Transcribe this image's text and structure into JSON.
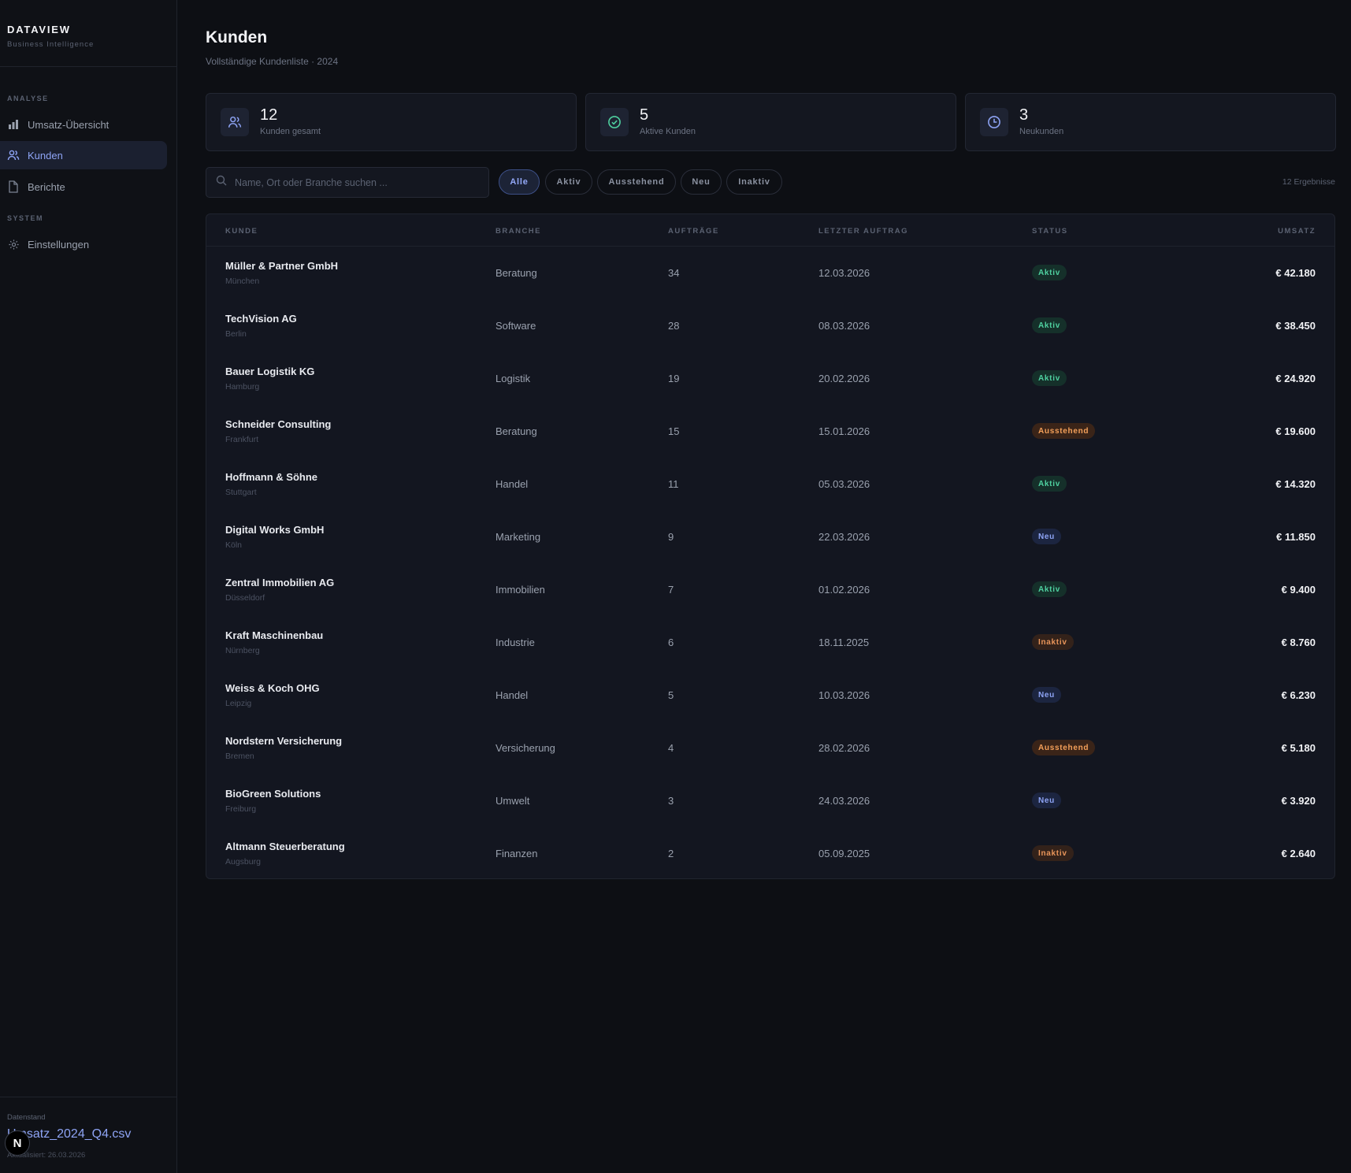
{
  "brand": {
    "title": "DATAVIEW",
    "subtitle": "Business Intelligence"
  },
  "nav": {
    "sections": [
      {
        "label": "ANALYSE"
      },
      {
        "label": "SYSTEM"
      }
    ],
    "items": [
      {
        "label": "Umsatz-Übersicht",
        "icon": "bar-chart-icon",
        "active": false
      },
      {
        "label": "Kunden",
        "icon": "users-icon",
        "active": true
      },
      {
        "label": "Berichte",
        "icon": "document-icon",
        "active": false
      },
      {
        "label": "Einstellungen",
        "icon": "gear-icon",
        "active": false
      }
    ]
  },
  "footer": {
    "label": "Datenstand",
    "file": "Umsatz_2024_Q4.csv",
    "updated": "Aktualisiert: 26.03.2026",
    "logo_letter": "N"
  },
  "page": {
    "title": "Kunden",
    "subtitle": "Vollständige Kundenliste · 2024"
  },
  "kpis": [
    {
      "value": "12",
      "label": "Kunden gesamt",
      "icon": "users-icon"
    },
    {
      "value": "5",
      "label": "Aktive Kunden",
      "icon": "check-circle-icon"
    },
    {
      "value": "3",
      "label": "Neukunden",
      "icon": "clock-icon"
    }
  ],
  "search": {
    "placeholder": "Name, Ort oder Branche suchen ...",
    "value": ""
  },
  "filters": [
    {
      "label": "Alle",
      "active": true
    },
    {
      "label": "Aktiv",
      "active": false
    },
    {
      "label": "Ausstehend",
      "active": false
    },
    {
      "label": "Neu",
      "active": false
    },
    {
      "label": "Inaktiv",
      "active": false
    }
  ],
  "result_count": "12 Ergebnisse",
  "table": {
    "columns": [
      "KUNDE",
      "BRANCHE",
      "AUFTRÄGE",
      "LETZTER AUFTRAG",
      "STATUS",
      "UMSATZ"
    ],
    "rows": [
      {
        "name": "Müller & Partner GmbH",
        "city": "München",
        "branch": "Beratung",
        "orders": "34",
        "date": "12.03.2026",
        "status": "Aktiv",
        "revenue": "€ 42.180"
      },
      {
        "name": "TechVision AG",
        "city": "Berlin",
        "branch": "Software",
        "orders": "28",
        "date": "08.03.2026",
        "status": "Aktiv",
        "revenue": "€ 38.450"
      },
      {
        "name": "Bauer Logistik KG",
        "city": "Hamburg",
        "branch": "Logistik",
        "orders": "19",
        "date": "20.02.2026",
        "status": "Aktiv",
        "revenue": "€ 24.920"
      },
      {
        "name": "Schneider Consulting",
        "city": "Frankfurt",
        "branch": "Beratung",
        "orders": "15",
        "date": "15.01.2026",
        "status": "Ausstehend",
        "revenue": "€ 19.600"
      },
      {
        "name": "Hoffmann & Söhne",
        "city": "Stuttgart",
        "branch": "Handel",
        "orders": "11",
        "date": "05.03.2026",
        "status": "Aktiv",
        "revenue": "€ 14.320"
      },
      {
        "name": "Digital Works GmbH",
        "city": "Köln",
        "branch": "Marketing",
        "orders": "9",
        "date": "22.03.2026",
        "status": "Neu",
        "revenue": "€ 11.850"
      },
      {
        "name": "Zentral Immobilien AG",
        "city": "Düsseldorf",
        "branch": "Immobilien",
        "orders": "7",
        "date": "01.02.2026",
        "status": "Aktiv",
        "revenue": "€ 9.400"
      },
      {
        "name": "Kraft Maschinenbau",
        "city": "Nürnberg",
        "branch": "Industrie",
        "orders": "6",
        "date": "18.11.2025",
        "status": "Inaktiv",
        "revenue": "€ 8.760"
      },
      {
        "name": "Weiss & Koch OHG",
        "city": "Leipzig",
        "branch": "Handel",
        "orders": "5",
        "date": "10.03.2026",
        "status": "Neu",
        "revenue": "€ 6.230"
      },
      {
        "name": "Nordstern Versicherung",
        "city": "Bremen",
        "branch": "Versicherung",
        "orders": "4",
        "date": "28.02.2026",
        "status": "Ausstehend",
        "revenue": "€ 5.180"
      },
      {
        "name": "BioGreen Solutions",
        "city": "Freiburg",
        "branch": "Umwelt",
        "orders": "3",
        "date": "24.03.2026",
        "status": "Neu",
        "revenue": "€ 3.920"
      },
      {
        "name": "Altmann Steuerberatung",
        "city": "Augsburg",
        "branch": "Finanzen",
        "orders": "2",
        "date": "05.09.2025",
        "status": "Inaktiv",
        "revenue": "€ 2.640"
      }
    ]
  },
  "status_colors": {
    "Aktiv": {
      "bg": "#15302a",
      "fg": "#4fd1a0"
    },
    "Ausstehend": {
      "bg": "#3a2418",
      "fg": "#f4a05a"
    },
    "Neu": {
      "bg": "#1c2540",
      "fg": "#8ea4f5"
    },
    "Inaktiv": {
      "bg": "#33221a",
      "fg": "#e8955a"
    }
  },
  "colors": {
    "accent": "#8ea4f5",
    "background": "#0d0f14",
    "panel": "#141720"
  }
}
